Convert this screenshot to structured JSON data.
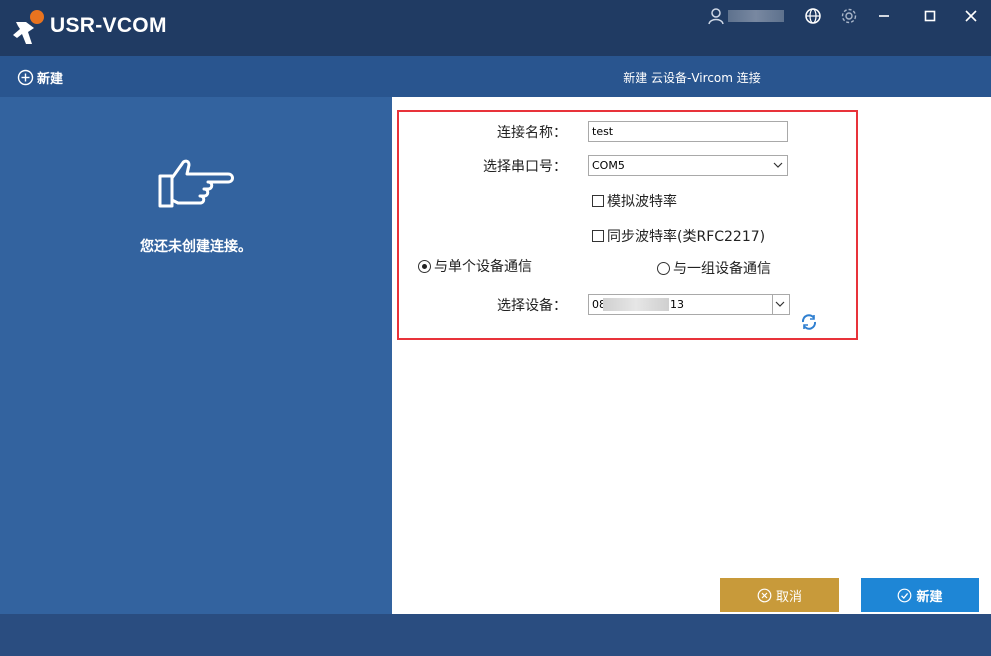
{
  "window": {
    "app_title": "USR-VCOM",
    "toolbar_icons": [
      "user-icon",
      "globe-icon",
      "gear-icon",
      "minimize-icon",
      "maximize-icon",
      "close-icon"
    ]
  },
  "toolbar": {
    "new_label": "新建",
    "dialog_title": "新建 云设备-Vircom 连接"
  },
  "left_panel": {
    "empty_message": "您还未创建连接。"
  },
  "form": {
    "conn_name_label": "连接名称：",
    "conn_name_value": "test",
    "serial_label": "选择串口号：",
    "serial_value": "COM5",
    "sim_baud_label": "模拟波特率",
    "sync_baud_label": "同步波特率(类RFC2217)",
    "radio_single_label": "与单个设备通信",
    "radio_group_label": "与一组设备通信",
    "device_label": "选择设备：",
    "device_value_prefix": "08",
    "device_value_suffix": "13"
  },
  "buttons": {
    "cancel_label": "取消",
    "create_label": "新建"
  },
  "colors": {
    "titlebar": "#203b63",
    "toolbar": "#29558f",
    "left_panel": "#33639f",
    "highlight_border": "#e8333a",
    "cancel_button": "#c89a3a",
    "create_button": "#1e86d6"
  }
}
